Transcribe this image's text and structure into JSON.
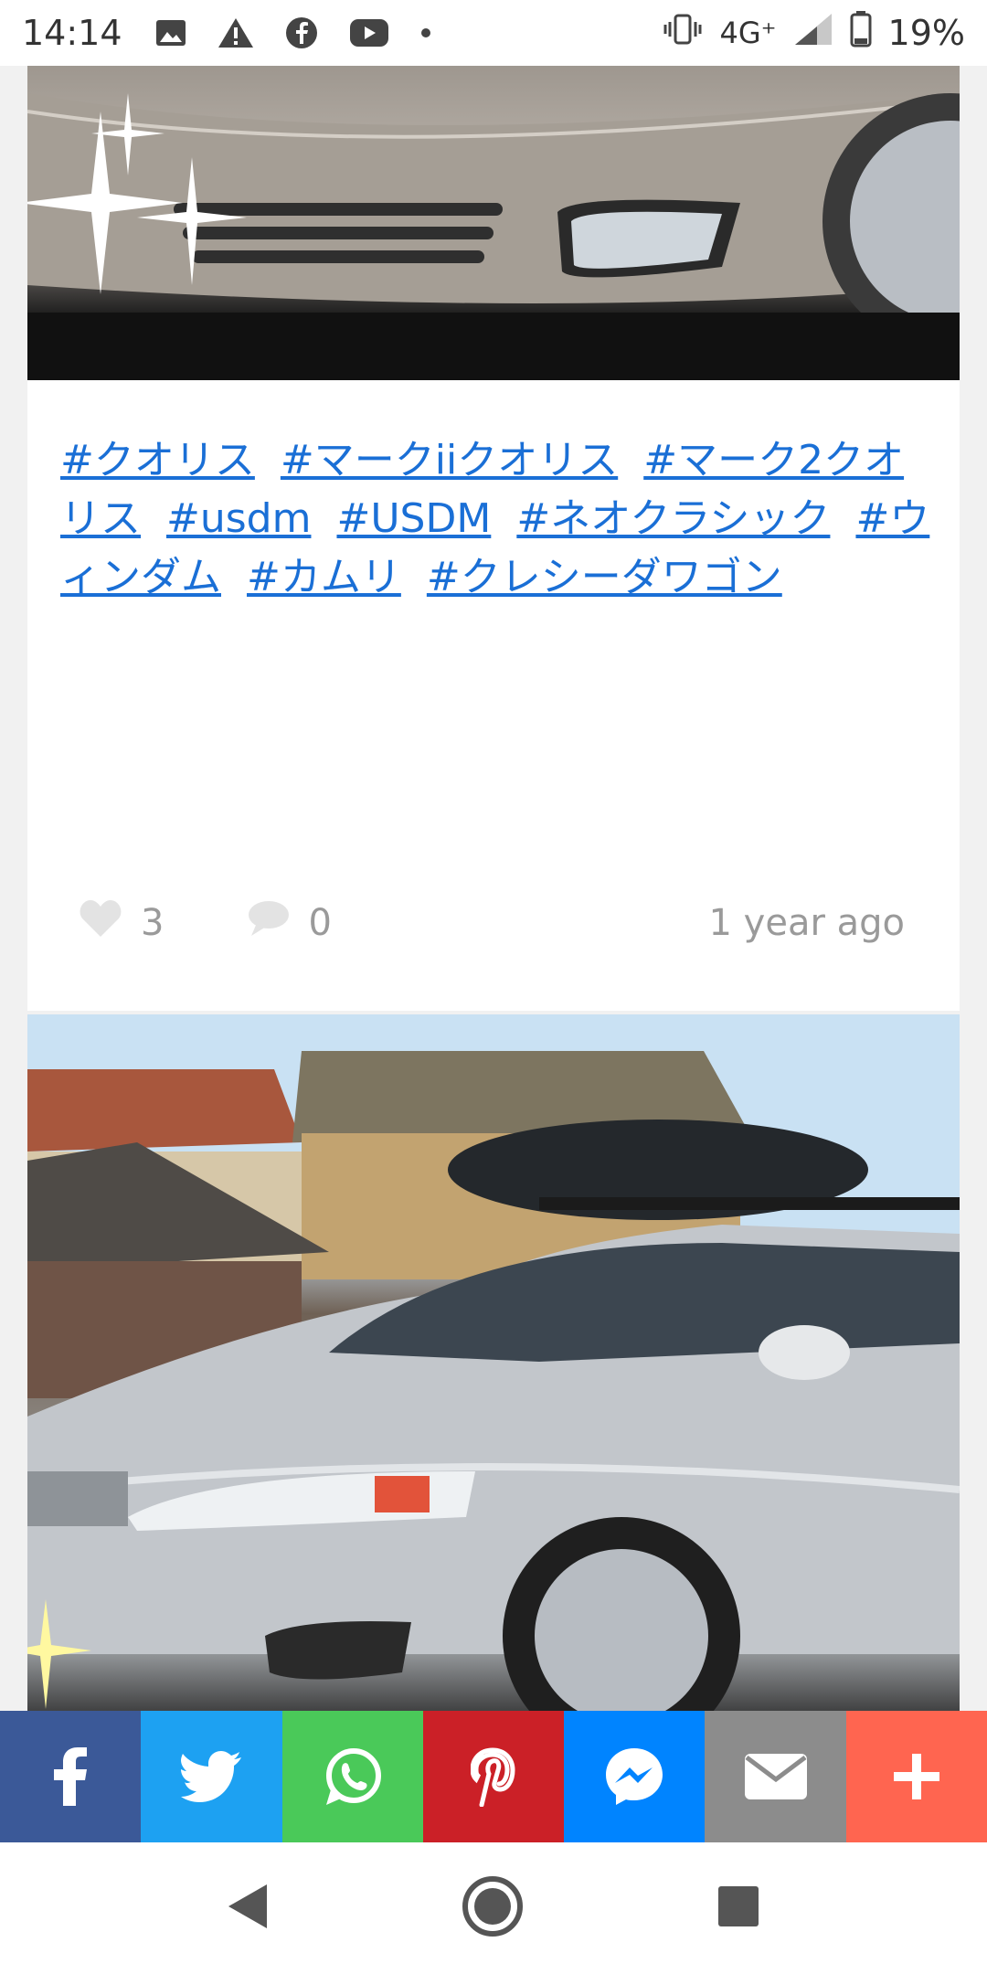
{
  "status_bar": {
    "time": "14:14",
    "network": "4G⁺",
    "battery": "19%",
    "icons": [
      "image-icon",
      "warning-icon",
      "facebook-icon",
      "youtube-icon",
      "dot-icon",
      "vibrate-icon",
      "signal-icon",
      "battery-icon"
    ]
  },
  "post1": {
    "tags": [
      "#クオリス",
      "#マークiiクオリス",
      "#マーク2クオリス",
      "#usdm",
      "#USDM",
      "#ネオクラシック",
      "#ウィンダム",
      "#カムリ",
      "#クレシーダワゴン"
    ],
    "likes": "3",
    "comments": "0",
    "posted": "1 year ago"
  },
  "share_bar": {
    "buttons": [
      {
        "name": "facebook",
        "color": "#3b5998",
        "glyph": "f"
      },
      {
        "name": "twitter",
        "color": "#1da1f2",
        "glyph": ""
      },
      {
        "name": "whatsapp",
        "color": "#4ac959",
        "glyph": ""
      },
      {
        "name": "pinterest",
        "color": "#cb2027",
        "glyph": "p"
      },
      {
        "name": "messenger",
        "color": "#0084ff",
        "glyph": ""
      },
      {
        "name": "email",
        "color": "#8c8c8c",
        "glyph": ""
      },
      {
        "name": "more",
        "color": "#ff6550",
        "glyph": "+"
      }
    ]
  },
  "colors": {
    "link": "#1a6fd6",
    "meta": "#9a9a9a",
    "background": "#f1f1f1"
  }
}
